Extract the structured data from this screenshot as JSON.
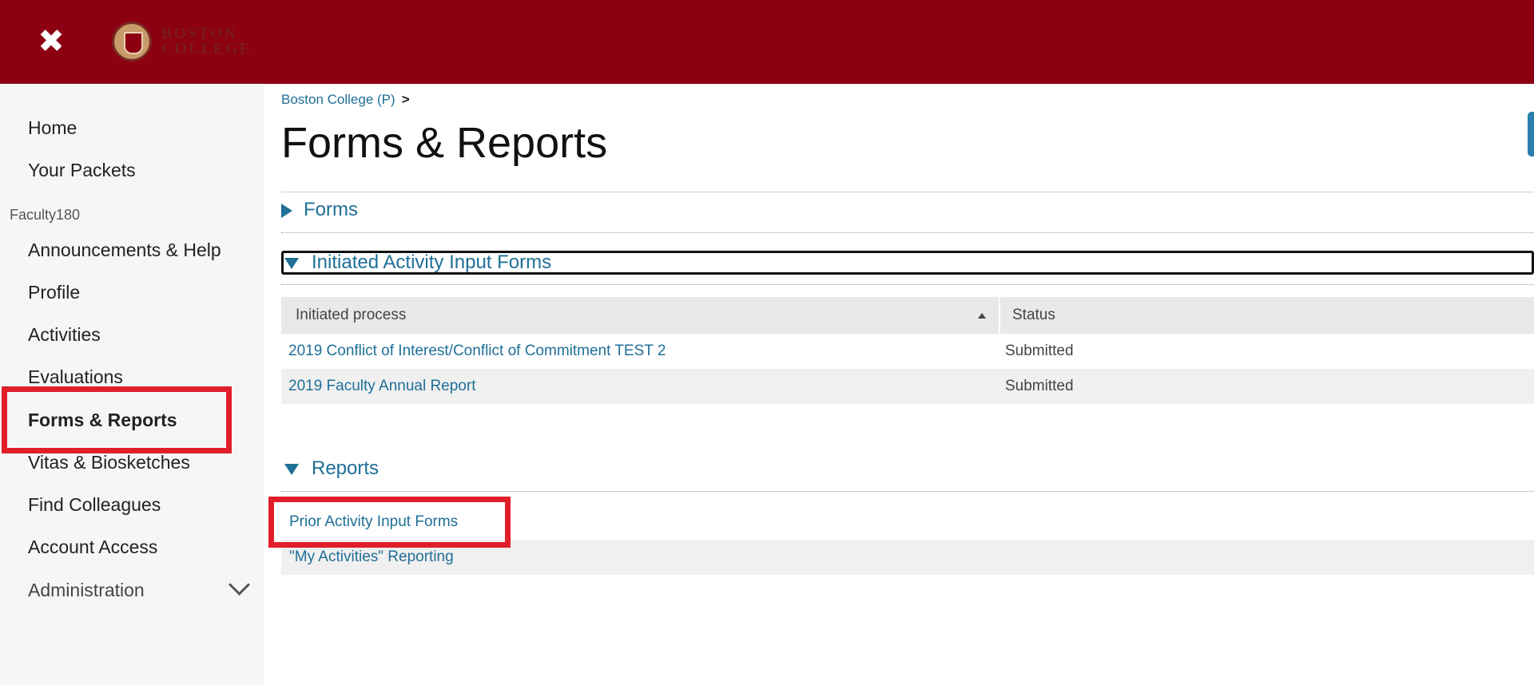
{
  "topbar": {
    "close_glyph": "✖",
    "logo_text_line1": "BOSTON",
    "logo_text_line2": "COLLEGE",
    "bg_color": "#8c0012"
  },
  "sidebar": {
    "items_top": [
      {
        "label": "Home"
      },
      {
        "label": "Your Packets"
      }
    ],
    "section_label": "Faculty180",
    "items": [
      {
        "label": "Announcements & Help"
      },
      {
        "label": "Profile"
      },
      {
        "label": "Activities"
      },
      {
        "label": "Evaluations"
      },
      {
        "label": "Forms & Reports",
        "active": true
      },
      {
        "label": "Vitas & Biosketches"
      },
      {
        "label": "Find Colleagues"
      },
      {
        "label": "Account Access"
      },
      {
        "label": "Administration"
      }
    ],
    "administration_icon": "chevron-down-icon"
  },
  "breadcrumb": {
    "item": "Boston College (P)",
    "separator": ">"
  },
  "page": {
    "title": "Forms & Reports"
  },
  "sections": {
    "forms": {
      "label": "Forms",
      "expanded": false
    },
    "initiated": {
      "label": "Initiated Activity Input Forms",
      "expanded": true
    },
    "reports": {
      "label": "Reports",
      "expanded": true
    }
  },
  "initiated_table": {
    "columns": [
      "Initiated process",
      "Status"
    ],
    "rows": [
      {
        "process": "2019 Conflict of Interest/Conflict of Commitment TEST 2",
        "status": "Submitted"
      },
      {
        "process": "2019 Faculty Annual Report",
        "status": "Submitted"
      }
    ]
  },
  "reports": {
    "items": [
      {
        "label": "Prior Activity Input Forms"
      },
      {
        "label": "\"My Activities\" Reporting"
      }
    ]
  },
  "colors": {
    "accent_link": "#1f6f97",
    "highlight": "#e01f2a"
  }
}
